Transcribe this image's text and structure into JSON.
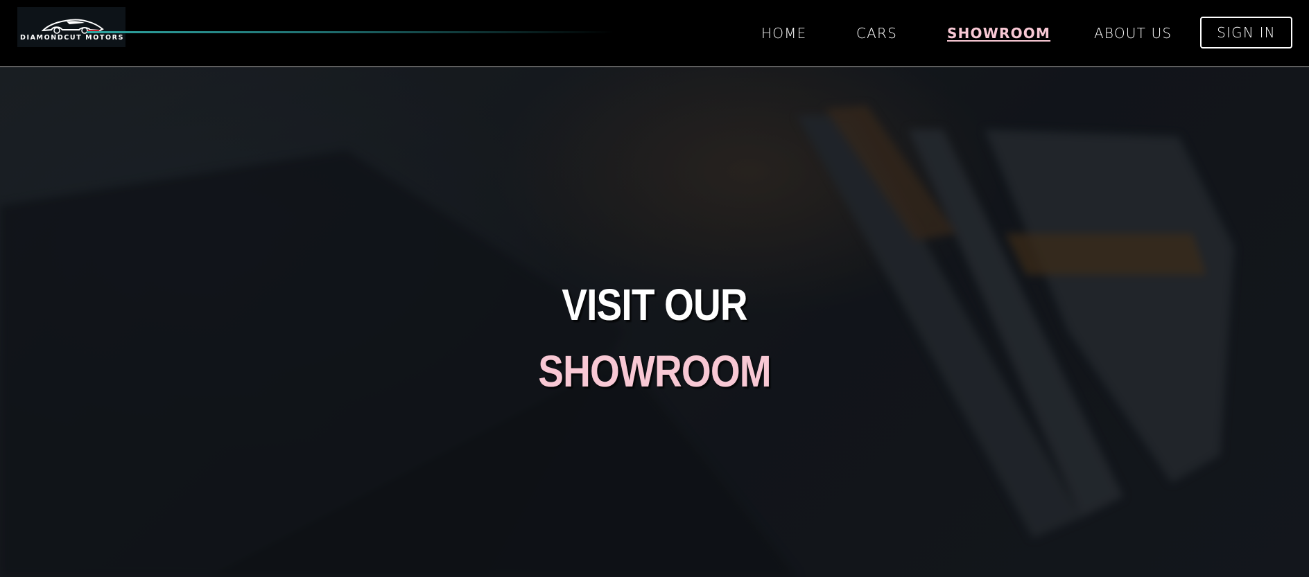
{
  "brand": {
    "name": "DIAMONDCUT MOTORS"
  },
  "nav": {
    "items": [
      {
        "label": "HOME"
      },
      {
        "label": "CARS"
      },
      {
        "label": "SHOWROOM",
        "active": true
      },
      {
        "label": "ABOUT US"
      }
    ],
    "sign_in_label": "SIGN IN"
  },
  "hero": {
    "title_line1": "VISIT OUR",
    "title_line2": "SHOWROOM"
  },
  "colors": {
    "accent_pink": "#f8c8d4",
    "accent_teal": "#2fa7a3",
    "header_bg": "#000000",
    "text": "#ffffff"
  }
}
